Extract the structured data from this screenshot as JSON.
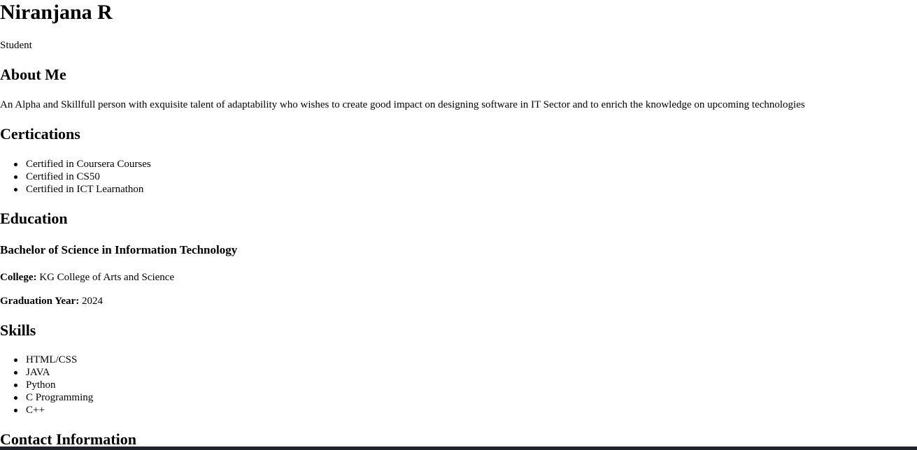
{
  "header": {
    "name": "Niranjana R",
    "role": "Student"
  },
  "about": {
    "heading": "About Me",
    "text": "An Alpha and Skillfull person with exquisite talent of adaptability who wishes to create good impact on designing software in IT Sector and to enrich the knowledge on upcoming technologies"
  },
  "certifications": {
    "heading": "Certications",
    "items": [
      "Certified in Coursera Courses",
      "Certified in CS50",
      "Certified in ICT Learnathon"
    ]
  },
  "education": {
    "heading": "Education",
    "degree": "Bachelor of Science in Information Technology",
    "college_label": "College:",
    "college_value": "KG College of Arts and Science",
    "year_label": "Graduation Year:",
    "year_value": "2024"
  },
  "skills": {
    "heading": "Skills",
    "items": [
      "HTML/CSS",
      "JAVA",
      "Python",
      "C Programming",
      "C++"
    ]
  },
  "contact": {
    "heading": "Contact Information"
  }
}
